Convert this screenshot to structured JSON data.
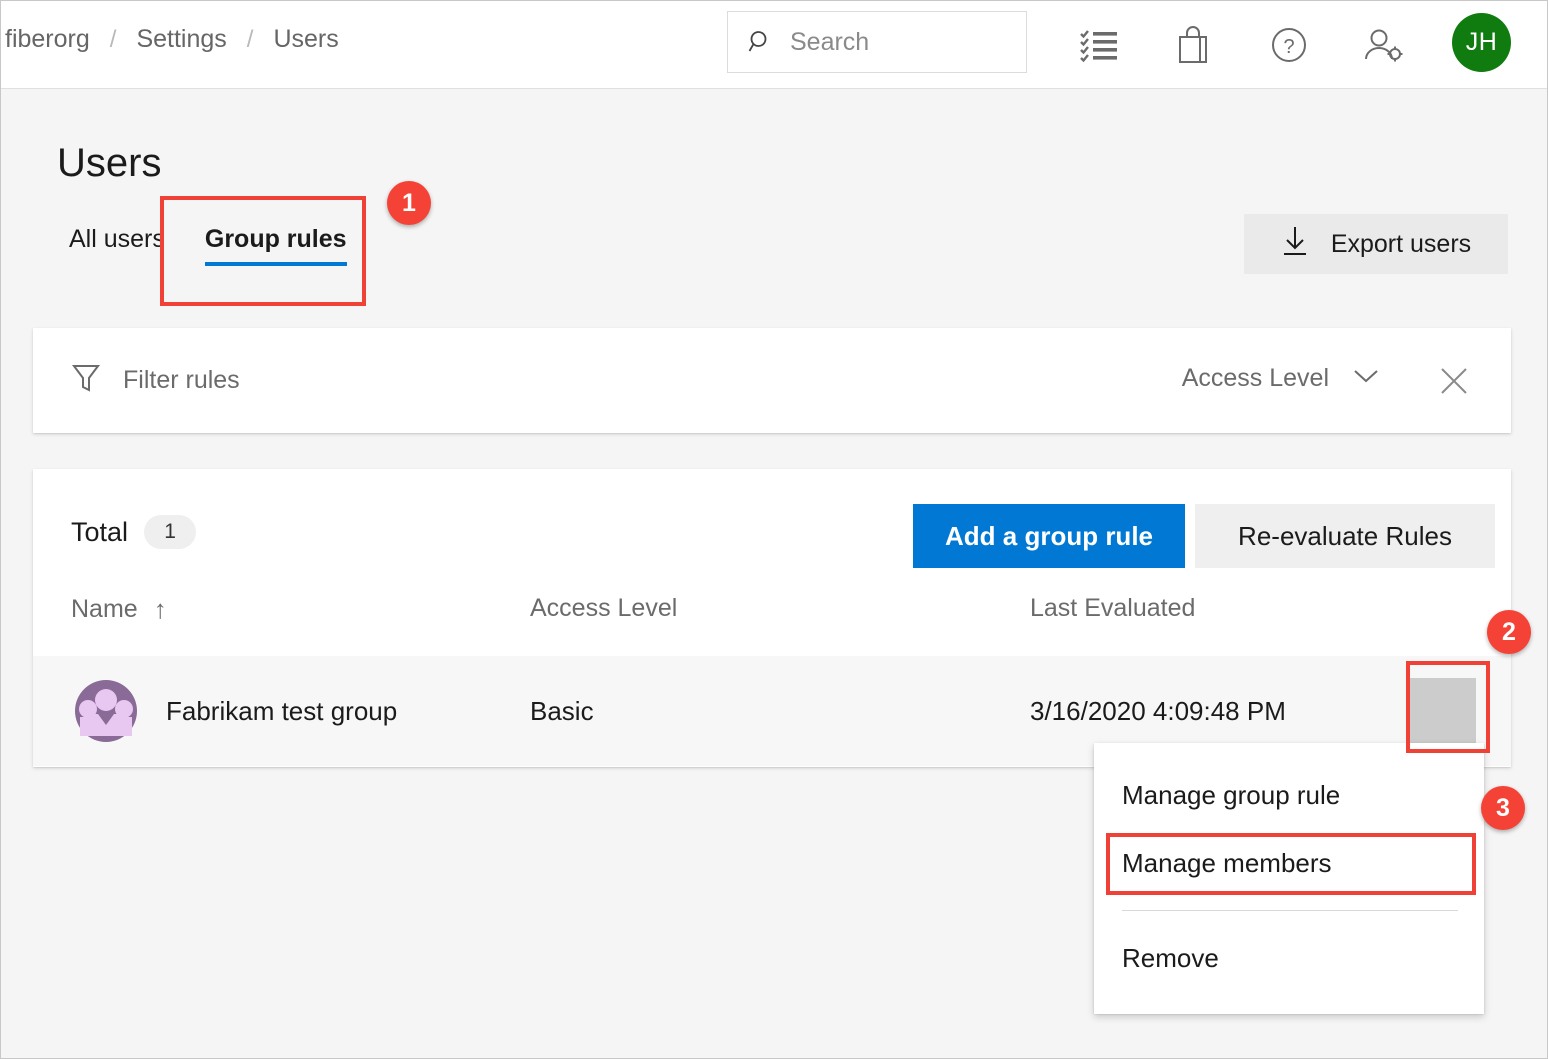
{
  "header": {
    "breadcrumb": [
      {
        "label": "fiberorg"
      },
      {
        "label": "Settings"
      },
      {
        "label": "Users"
      }
    ],
    "separator": "/",
    "search": {
      "value": "",
      "placeholder": "Search",
      "icon": "search-icon"
    },
    "icons": [
      {
        "name": "task-list-icon",
        "title": "Tasks"
      },
      {
        "name": "marketplace-bag-icon",
        "title": "Marketplace"
      },
      {
        "name": "help-question-icon",
        "title": "Help"
      },
      {
        "name": "user-settings-icon",
        "title": "User settings"
      }
    ],
    "avatar": {
      "initials": "JH",
      "color": "#107c10"
    }
  },
  "page": {
    "title": "Users",
    "tabs": [
      {
        "label": "All users",
        "active": false
      },
      {
        "label": "Group rules",
        "active": true
      }
    ],
    "export_button": {
      "label": "Export users",
      "icon": "download-icon"
    }
  },
  "filter": {
    "icon": "funnel-icon",
    "input_value": "",
    "input_placeholder": "Filter rules",
    "dropdown_label": "Access Level",
    "dropdown_icon": "chevron-down-icon",
    "clear_icon": "close-icon"
  },
  "table": {
    "total_label": "Total",
    "total_count": "1",
    "primary_button": "Add a group rule",
    "secondary_button": "Re-evaluate Rules",
    "columns": [
      {
        "label": "Name",
        "sort": "↑"
      },
      {
        "label": "Access Level",
        "sort": ""
      },
      {
        "label": "Last Evaluated",
        "sort": ""
      }
    ],
    "rows": [
      {
        "avatar_icon": "group-avatar-icon",
        "name": "Fabrikam test group",
        "access_level": "Basic",
        "last_evaluated": "3/16/2020 4:09:48 PM",
        "menu_icon": "more-vertical-icon"
      }
    ]
  },
  "context_menu": {
    "items": [
      {
        "label": "Manage group rule",
        "highlighted": false
      },
      {
        "label": "Manage members",
        "highlighted": true
      },
      {
        "label": "Remove",
        "highlighted": false
      }
    ]
  },
  "annotations": {
    "badges": [
      {
        "number": "1",
        "target": "group-rules-tab"
      },
      {
        "number": "2",
        "target": "row-more-menu-button"
      },
      {
        "number": "3",
        "target": "manage-members-menu-item"
      }
    ],
    "highlight_color": "#ef4136",
    "badge_color": "#f44336"
  },
  "colors": {
    "accent": "#0078d4",
    "avatar_green": "#107c10",
    "group_avatar_purple": "#8a6a96",
    "group_avatar_light": "#e8c8f0",
    "page_background": "#f5f5f5"
  }
}
